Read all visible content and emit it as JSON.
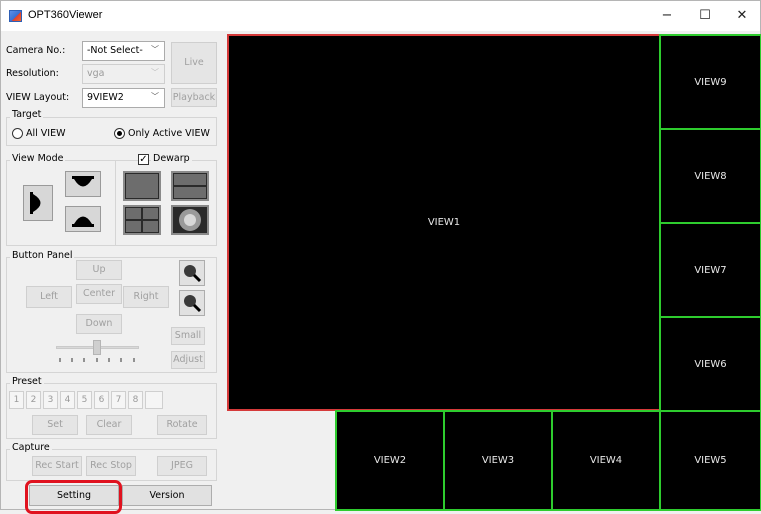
{
  "window": {
    "title": "OPT360Viewer",
    "minimize": "−",
    "maximize": "☐",
    "close": "✕"
  },
  "camera": {
    "label": "Camera No.:",
    "value": "-Not Select-"
  },
  "resolution": {
    "label": "Resolution:",
    "value": "vga"
  },
  "layout": {
    "label": "VIEW Layout:",
    "value": "9VIEW2"
  },
  "buttons": {
    "live": "Live",
    "playback": "Playback"
  },
  "target": {
    "title": "Target",
    "all": "All VIEW",
    "active": "Only Active VIEW",
    "selected": "active"
  },
  "view_mode": {
    "title": "View Mode",
    "dewarp_label": "Dewarp",
    "dewarp_checked": true
  },
  "button_panel": {
    "title": "Button Panel",
    "up": "Up",
    "left": "Left",
    "center": "Center",
    "right": "Right",
    "down": "Down",
    "small": "Small",
    "adjust": "Adjust"
  },
  "preset": {
    "title": "Preset",
    "numbers": [
      "1",
      "2",
      "3",
      "4",
      "5",
      "6",
      "7",
      "8"
    ],
    "set": "Set",
    "clear": "Clear",
    "rotate": "Rotate"
  },
  "capture": {
    "title": "Capture",
    "rec_start": "Rec Start",
    "rec_stop": "Rec Stop",
    "jpeg": "JPEG"
  },
  "bottom": {
    "setting": "Setting",
    "version": "Version"
  },
  "views": {
    "v1": "VIEW1",
    "v2": "VIEW2",
    "v3": "VIEW3",
    "v4": "VIEW4",
    "v5": "VIEW5",
    "v6": "VIEW6",
    "v7": "VIEW7",
    "v8": "VIEW8",
    "v9": "VIEW9"
  },
  "colors": {
    "active_border": "#d53a3a",
    "view_border": "#2ecc2e",
    "highlight": "#e0121f"
  }
}
